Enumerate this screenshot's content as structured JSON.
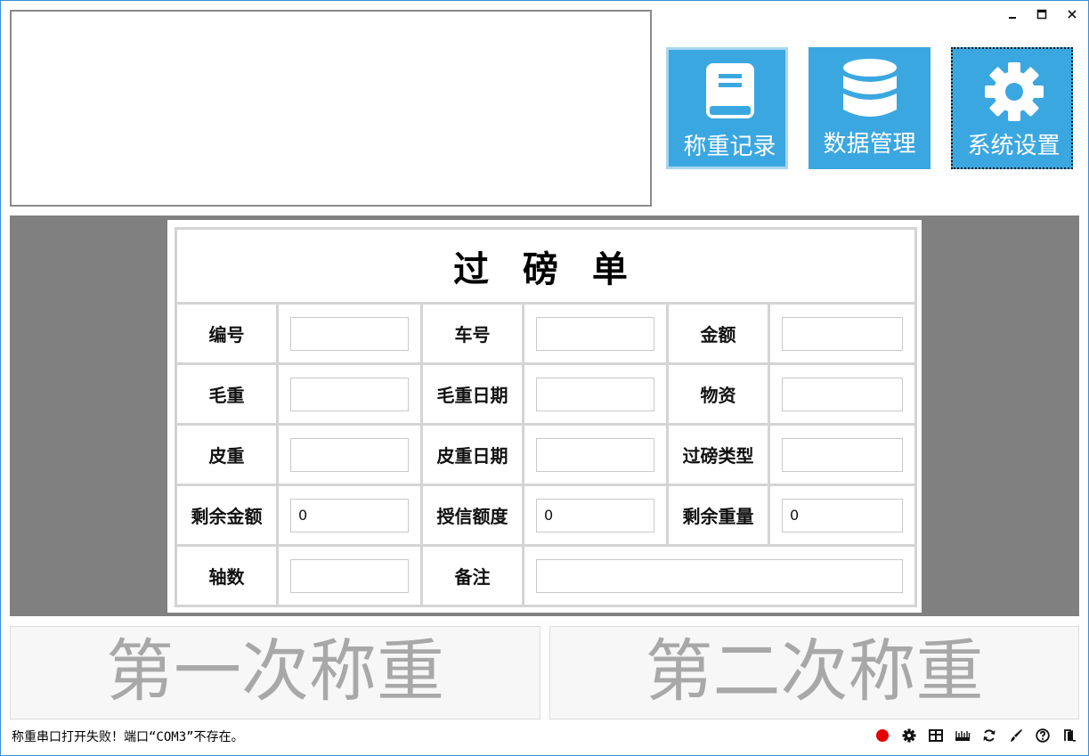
{
  "window_controls": {
    "minimize_label": "▁",
    "maximize_label": "□",
    "close_label": "✕"
  },
  "toolbar": {
    "record_label": "称重记录",
    "data_label": "数据管理",
    "settings_label": "系统设置",
    "record_icon": "book-icon",
    "data_icon": "database-icon",
    "settings_icon": "gear-icon"
  },
  "form": {
    "title": "过 磅 单",
    "rows": [
      [
        {
          "label": "编号",
          "value": ""
        },
        {
          "label": "车号",
          "value": ""
        },
        {
          "label": "金额",
          "value": ""
        }
      ],
      [
        {
          "label": "毛重",
          "value": ""
        },
        {
          "label": "毛重日期",
          "value": ""
        },
        {
          "label": "物资",
          "value": ""
        }
      ],
      [
        {
          "label": "皮重",
          "value": ""
        },
        {
          "label": "皮重日期",
          "value": ""
        },
        {
          "label": "过磅类型",
          "value": ""
        }
      ],
      [
        {
          "label": "剩余金额",
          "value": "0"
        },
        {
          "label": "授信额度",
          "value": "0"
        },
        {
          "label": "剩余重量",
          "value": "0"
        }
      ]
    ],
    "last_row": {
      "axle_label": "轴数",
      "axle_value": "",
      "remark_label": "备注",
      "remark_value": ""
    }
  },
  "buttons": {
    "first_weigh": "第一次称重",
    "second_weigh": "第二次称重"
  },
  "status": {
    "message": "称重串口打开失败！端口“COM3”不存在。",
    "indicator_color": "#e30000",
    "icons": [
      "status-dot-icon",
      "gear-icon",
      "table-icon",
      "ruler-icon",
      "refresh-icon",
      "brush-icon",
      "help-icon",
      "exit-icon"
    ]
  },
  "colors": {
    "tile_blue": "#3ba7e0",
    "background_gray": "#808080"
  }
}
